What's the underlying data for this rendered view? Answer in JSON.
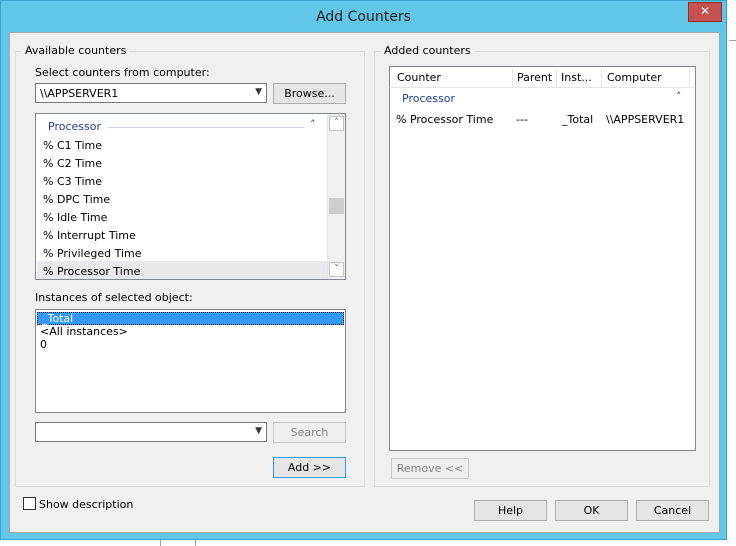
{
  "window": {
    "title": "Add Counters",
    "close_glyph": "✕"
  },
  "available": {
    "group_label": "Available counters",
    "computer_label": "Select counters from computer:",
    "computer_value": "\\\\APPSERVER1",
    "browse_label": "Browse...",
    "object_header": "Processor",
    "counters": [
      "% C1 Time",
      "% C2 Time",
      "% C3 Time",
      "% DPC Time",
      "% Idle Time",
      "% Interrupt Time",
      "% Privileged Time",
      "% Processor Time"
    ],
    "instances_label": "Instances of selected object:",
    "instances": [
      "_Total",
      "<All instances>",
      "0"
    ],
    "search_value": "",
    "search_label": "Search",
    "add_label": "Add >>"
  },
  "added": {
    "group_label": "Added counters",
    "columns": [
      "Counter",
      "Parent",
      "Inst...",
      "Computer"
    ],
    "object_header": "Processor",
    "rows": [
      {
        "counter": "% Processor Time",
        "parent": "---",
        "instance": "_Total",
        "computer": "\\\\APPSERVER1"
      }
    ],
    "remove_label": "Remove <<"
  },
  "footer": {
    "show_description_label": "Show description",
    "help_label": "Help",
    "ok_label": "OK",
    "cancel_label": "Cancel"
  }
}
